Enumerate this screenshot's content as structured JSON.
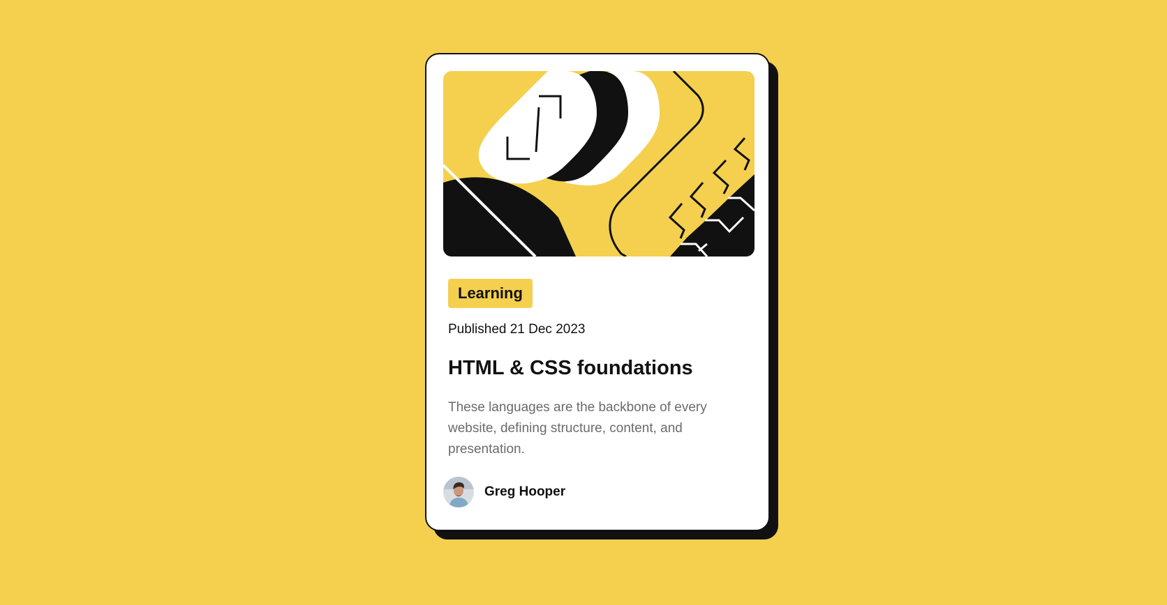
{
  "colors": {
    "background": "#F4D04E",
    "card": "#FFFFFF",
    "ink": "#111111",
    "muted_text": "#6B6B6B"
  },
  "card": {
    "illustration": "abstract-illustration",
    "tag": "Learning",
    "published": "Published 21 Dec 2023",
    "title": "HTML & CSS foundations",
    "description": "These languages are the backbone of every website, defining structure, content, and presentation.",
    "author": {
      "avatar": "avatar-photo",
      "name": "Greg Hooper"
    }
  }
}
